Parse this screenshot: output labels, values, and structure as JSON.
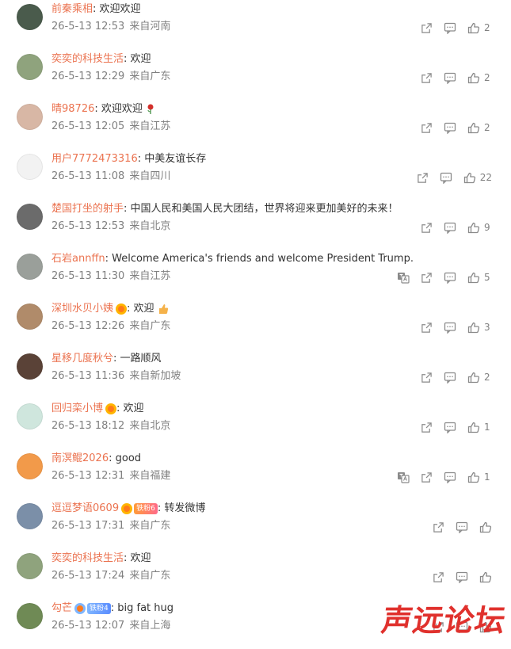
{
  "comments": [
    {
      "user": "前秦乘相",
      "text": "欢迎欢迎",
      "date": "26-5-13 12:53",
      "loc": "来自河南",
      "likes": "2",
      "translate": false,
      "avatar": "#4a5b4c"
    },
    {
      "user": "奕奕的科技生活",
      "text": "欢迎",
      "date": "26-5-13 12:29",
      "loc": "来自广东",
      "likes": "2",
      "translate": false,
      "avatar": "#8fa37d"
    },
    {
      "user": "晴98726",
      "text": "欢迎欢迎",
      "date": "26-5-13 12:05",
      "loc": "来自江苏",
      "likes": "2",
      "translate": false,
      "avatar": "#d8b7a5"
    },
    {
      "user": "用户7772473316",
      "text": "中美友谊长存",
      "date": "26-5-13 11:08",
      "loc": "来自四川",
      "likes": "22",
      "translate": false,
      "avatar": "#f2f2f2"
    },
    {
      "user": "楚国打坐的射手",
      "text": "中国人民和美国人民大团结，世界将迎来更加美好的未来！",
      "date": "26-5-13 12:53",
      "loc": "来自北京",
      "likes": "9",
      "translate": false,
      "avatar": "#6b6b6b"
    },
    {
      "user": "石岩annffn",
      "text": "Welcome America's friends and welcome President Trump.",
      "date": "26-5-13 11:30",
      "loc": "来自江苏",
      "likes": "5",
      "translate": true,
      "avatar": "#9a9f9a"
    },
    {
      "user": "深圳水贝小姨",
      "text": "欢迎",
      "date": "26-5-13 12:26",
      "loc": "来自广东",
      "likes": "3",
      "translate": false,
      "avatar": "#b08b6a"
    },
    {
      "user": "星移几度秋兮",
      "text": "一路顺风",
      "date": "26-5-13 11:36",
      "loc": "来自新加坡",
      "likes": "2",
      "translate": false,
      "avatar": "#5a4237"
    },
    {
      "user": "回归栾小博",
      "text": "欢迎",
      "date": "26-5-13 18:12",
      "loc": "来自北京",
      "likes": "1",
      "translate": false,
      "avatar": "#cfe6dd"
    },
    {
      "user": "南溟鲲2026",
      "text": "good",
      "date": "26-5-13 12:31",
      "loc": "来自福建",
      "likes": "1",
      "translate": true,
      "avatar": "#f29a4a"
    },
    {
      "user": "逗逗梦语0609",
      "text": "转发微博",
      "date": "26-5-13 17:31",
      "loc": "来自广东",
      "likes": "",
      "translate": false,
      "avatar": "#7b8fa8",
      "fan_badge": "铁粉6"
    },
    {
      "user": "奕奕的科技生活",
      "text": "欢迎",
      "date": "26-5-13 17:24",
      "loc": "来自广东",
      "likes": "",
      "translate": false,
      "avatar": "#8fa37d"
    },
    {
      "user": "勾芒",
      "text": "big fat hug",
      "date": "26-5-13 12:07",
      "loc": "来自上海",
      "likes": "",
      "translate": false,
      "avatar": "#6f8a55",
      "fan_badge": "铁粉4"
    }
  ],
  "watermark": "声远论坛",
  "colors": {
    "username": "#eb7350",
    "meta": "#808080",
    "text": "#333333",
    "watermark": "#e0312d"
  }
}
